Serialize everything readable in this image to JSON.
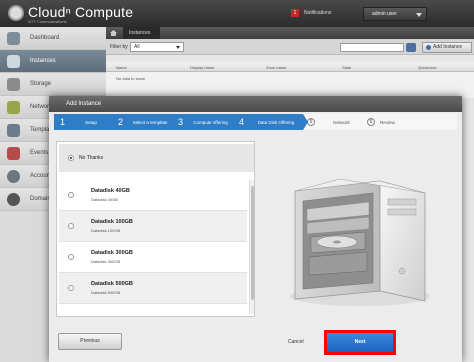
{
  "header": {
    "logo_text": "Cloudⁿ Compute",
    "logo_sub": "NTT Communications",
    "notifications_count": "1",
    "notifications_label": "Notifications",
    "user_name": "admin user"
  },
  "sidebar": {
    "items": [
      {
        "label": "Dashboard",
        "icon": "dashboard-icon"
      },
      {
        "label": "Instances",
        "icon": "cloud-icon"
      },
      {
        "label": "Storage",
        "icon": "storage-icon"
      },
      {
        "label": "Network",
        "icon": "network-icon"
      },
      {
        "label": "Templates",
        "icon": "template-icon"
      },
      {
        "label": "Events",
        "icon": "calendar-icon"
      },
      {
        "label": "Accounts",
        "icon": "user-icon"
      },
      {
        "label": "Domains",
        "icon": "domain-icon"
      }
    ]
  },
  "content": {
    "breadcrumb": "Instances",
    "filter_label": "Filter by",
    "filter_value": "All",
    "add_button": "Add Instance",
    "columns": [
      "Name",
      "Display name",
      "Zone name",
      "State",
      "Quickview"
    ],
    "no_data": "No data to show"
  },
  "dialog": {
    "title": "Add Instance",
    "steps": [
      {
        "num": "1",
        "label": "Setup"
      },
      {
        "num": "2",
        "label": "Select a template"
      },
      {
        "num": "3",
        "label": "Compute offering"
      },
      {
        "num": "4",
        "label": "Data Disk Offering"
      },
      {
        "num": "5",
        "label": "Network"
      },
      {
        "num": "6",
        "label": "Review"
      }
    ],
    "no_thanks": "No Thanks",
    "options": [
      {
        "name": "Datadisk 40GB",
        "desc": "Datadisk 40GB"
      },
      {
        "name": "Datadisk 100GB",
        "desc": "Datadisk 100GB"
      },
      {
        "name": "Datadisk 300GB",
        "desc": "Datadisk 300GB"
      },
      {
        "name": "Datadisk 500GB",
        "desc": "Datadisk 500GB"
      }
    ],
    "previous": "Previous",
    "cancel": "Cancel",
    "next": "Next"
  },
  "colors": {
    "accent": "#2f7cc7",
    "highlight": "#ff0000"
  }
}
